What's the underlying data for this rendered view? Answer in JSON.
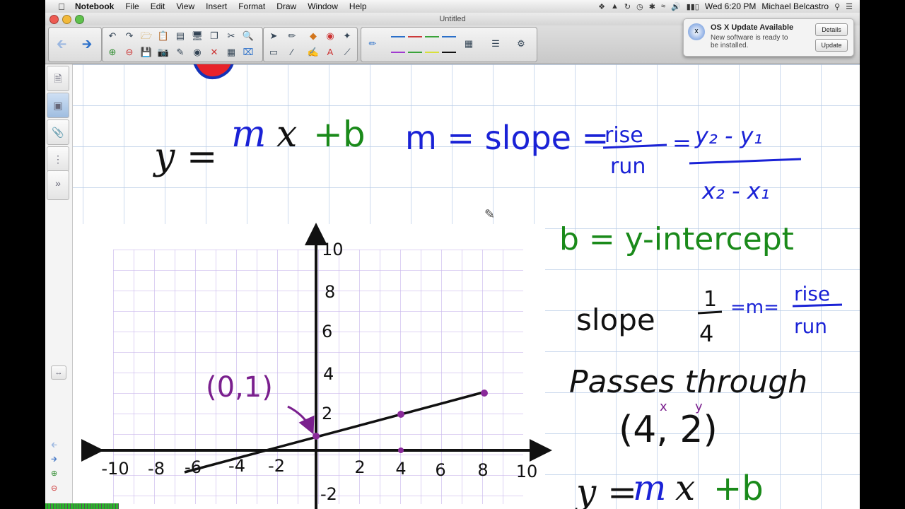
{
  "menubar": {
    "apple_icon": "apple-icon",
    "items": [
      "Notebook",
      "File",
      "Edit",
      "View",
      "Insert",
      "Format",
      "Draw",
      "Window",
      "Help"
    ],
    "clock": "Wed 6:20 PM",
    "user": "Michael Belcastro"
  },
  "window": {
    "title": "Untitled"
  },
  "notification": {
    "title": "OS X Update Available",
    "body": "New software is ready to be installed.",
    "details_label": "Details",
    "update_label": "Update"
  },
  "notebook": {
    "equation_y": "y =",
    "equation_m": "m",
    "equation_x": "x",
    "equation_b": "+b",
    "slope_def": "m = slope =",
    "rise": "rise",
    "run": "run",
    "formula_top": "y₂ - y₁",
    "formula_bottom": "x₂ - x₁",
    "intercept_def": "b = y-intercept",
    "slope_label": "slope",
    "slope_num": "1",
    "slope_den": "4",
    "eq_m": "=m=",
    "rise2": "rise",
    "run2": "run",
    "passes": "Passes through",
    "point": "(4, 2)",
    "point_x_tag": "x",
    "point_y_tag": "y",
    "intercept_point": "(0,1)",
    "bottom_eq_y": "y =",
    "bottom_eq_m": "m",
    "bottom_eq_x": "x",
    "bottom_eq_b": "+b",
    "x_ticks": [
      "-10",
      "-8",
      "-6",
      "-4",
      "-2",
      "2",
      "4",
      "6",
      "8",
      "10"
    ],
    "y_ticks": [
      "10",
      "8",
      "6",
      "4",
      "2",
      "-2"
    ]
  },
  "colors": {
    "ink_black": "#111111",
    "ink_blue": "#1a22d6",
    "ink_green": "#1a8a1a",
    "ink_purple": "#7a1f8e",
    "grid_blue": "#b7cbe6",
    "graph_purple": "#c9b8ec"
  }
}
